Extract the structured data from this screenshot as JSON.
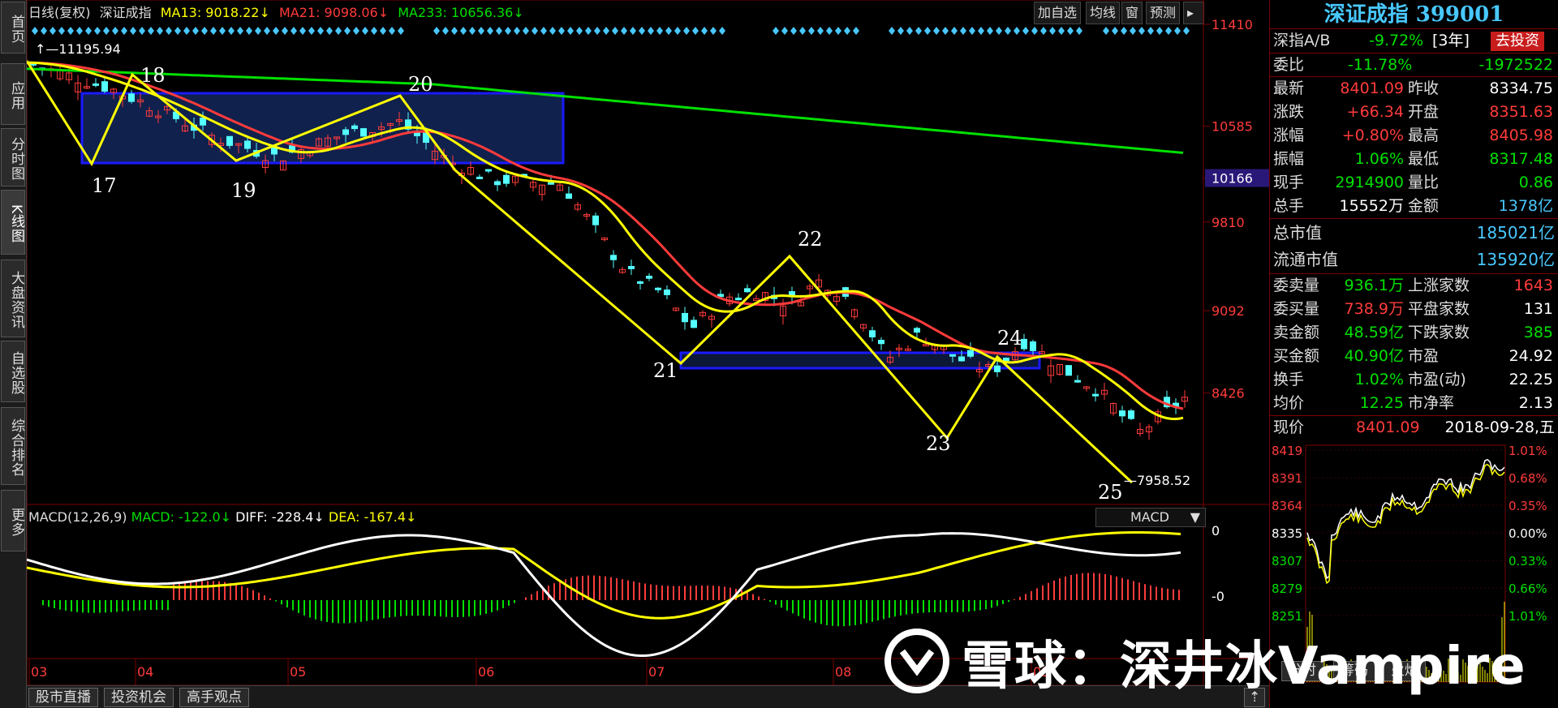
{
  "nav": [
    "首页",
    "应用",
    "分时图",
    "K线图",
    "大盘资讯",
    "自选股",
    "综合排名",
    "更多"
  ],
  "topbar": {
    "period": "日线(复权)",
    "index_name": "深证成指",
    "ma13": "MA13: 9018.22↓",
    "ma21": "MA21: 9098.06↓",
    "ma233": "MA233: 10656.36↓",
    "buttons": [
      "加自选",
      "均线",
      "窗",
      "预测"
    ]
  },
  "price_axis": {
    "ticks": [
      "11410",
      "10585",
      "10166",
      "9810",
      "9092",
      "8426"
    ],
    "highlight": "10166"
  },
  "chart_annotations": {
    "high_label": "11195.94",
    "low_label": "7958.52",
    "wave_labels": [
      "17",
      "18",
      "19",
      "20",
      "21",
      "22",
      "23",
      "24",
      "25"
    ]
  },
  "macd": {
    "title": "MACD(12,26,9)",
    "macd": "MACD: -122.0↓",
    "diff": "DIFF: -228.4↓",
    "dea": "DEA: -167.4↓",
    "selector": "MACD",
    "axis": [
      "0",
      "-0"
    ]
  },
  "month_labels": [
    "03",
    "04",
    "05",
    "06",
    "07",
    "08",
    "09"
  ],
  "bottom_tabs": [
    "股市直播",
    "投资机会",
    "高手观点"
  ],
  "right_panel": {
    "title": "深证成指 399001",
    "ab": {
      "label": "深指A/B",
      "value": "-9.72%",
      "period": "[3年]",
      "button": "去投资"
    },
    "weibi": {
      "label": "委比",
      "pct": "-11.78%",
      "val": "-1972522"
    },
    "quotes": [
      {
        "l1": "最新",
        "v1": "8401.09",
        "c1": "red",
        "l2": "昨收",
        "v2": "8334.75",
        "c2": "white"
      },
      {
        "l1": "涨跌",
        "v1": "+66.34",
        "c1": "red",
        "l2": "开盘",
        "v2": "8351.63",
        "c2": "red"
      },
      {
        "l1": "涨幅",
        "v1": "+0.80%",
        "c1": "red",
        "l2": "最高",
        "v2": "8405.98",
        "c2": "red"
      },
      {
        "l1": "振幅",
        "v1": "1.06%",
        "c1": "green",
        "l2": "最低",
        "v2": "8317.48",
        "c2": "green"
      },
      {
        "l1": "现手",
        "v1": "2914900",
        "c1": "green",
        "l2": "量比",
        "v2": "0.86",
        "c2": "green"
      },
      {
        "l1": "总手",
        "v1": "15552万",
        "c1": "white",
        "l2": "金额",
        "v2": "1378亿",
        "c2": "cyan"
      }
    ],
    "market_value": {
      "label": "总市值",
      "value": "185021亿"
    },
    "float_value": {
      "label": "流通市值",
      "value": "135920亿"
    },
    "stats": [
      {
        "l1": "委卖量",
        "v1": "936.1万",
        "c1": "green",
        "l2": "上涨家数",
        "v2": "1643",
        "c2": "red"
      },
      {
        "l1": "委买量",
        "v1": "738.9万",
        "c1": "red",
        "l2": "平盘家数",
        "v2": "131",
        "c2": "white"
      },
      {
        "l1": "卖金额",
        "v1": "48.59亿",
        "c1": "green",
        "l2": "下跌家数",
        "v2": "385",
        "c2": "green"
      },
      {
        "l1": "买金额",
        "v1": "40.90亿",
        "c1": "green",
        "l2": "市盈",
        "v2": "24.92",
        "c2": "white"
      },
      {
        "l1": "换手",
        "v1": "1.02%",
        "c1": "green",
        "l2": "市盈(动)",
        "v2": "22.25",
        "c2": "white"
      },
      {
        "l1": "均价",
        "v1": "12.25",
        "c1": "green",
        "l2": "市净率",
        "v2": "2.13",
        "c2": "white"
      }
    ],
    "intraday": {
      "label": "现价",
      "price": "8401.09",
      "date": "2018-09-28,五",
      "left_ticks": [
        "8419",
        "8391",
        "8364",
        "8335",
        "8307",
        "8279",
        "8251"
      ],
      "right_ticks": [
        "1.01%",
        "0.68%",
        "0.35%",
        "0.00%",
        "0.33%",
        "0.66%",
        "1.01%"
      ]
    },
    "tabs": [
      "分时",
      "筹码",
      "火焰"
    ]
  },
  "watermark": "雪球：深井冰Vampire",
  "colors": {
    "up": "#ff3b3b",
    "down": "#00e0ff",
    "ma13": "#ffff00",
    "ma21": "#ff3b3b",
    "ma233": "#00e000",
    "wave": "#ffff00",
    "box": "#1a1aff"
  }
}
